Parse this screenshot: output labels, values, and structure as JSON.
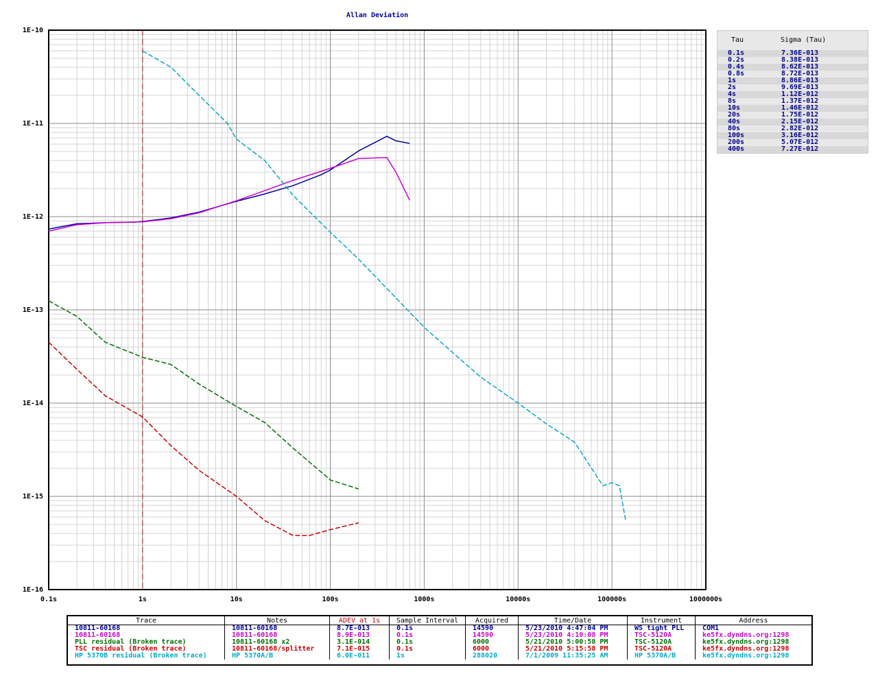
{
  "chart_data": {
    "type": "line",
    "title": "Allan Deviation",
    "x_scale": "log",
    "y_scale": "log",
    "xlim": [
      0.1,
      1000000
    ],
    "ylim": [
      1e-16,
      1e-10
    ],
    "grid": true,
    "x_tick_labels": [
      "0.1s",
      "1s",
      "10s",
      "100s",
      "1000s",
      "10000s",
      "100000s",
      "1000000s"
    ],
    "y_tick_labels": [
      "1E-10",
      "1E-11",
      "1E-12",
      "1E-13",
      "1E-14",
      "1E-15",
      "1E-16"
    ],
    "marker_tau": 1,
    "series": [
      {
        "name": "10811-60168",
        "color": "#0000aa",
        "dashed": false,
        "x": [
          0.1,
          0.2,
          0.4,
          0.8,
          1,
          2,
          4,
          8,
          10,
          20,
          40,
          80,
          100,
          200,
          400,
          500,
          700
        ],
        "y": [
          7.36e-13,
          8.38e-13,
          8.62e-13,
          8.72e-13,
          8.86e-13,
          9.69e-13,
          1.12e-12,
          1.37e-12,
          1.46e-12,
          1.75e-12,
          2.15e-12,
          2.82e-12,
          3.16e-12,
          5.07e-12,
          7.27e-12,
          6.5e-12,
          6.1e-12
        ]
      },
      {
        "name": "10811-60168",
        "color": "#cc00cc",
        "dashed": false,
        "x": [
          0.1,
          0.2,
          0.4,
          1,
          2,
          4,
          10,
          20,
          40,
          100,
          200,
          400,
          500,
          700
        ],
        "y": [
          7e-13,
          8.2e-13,
          8.6e-13,
          8.8e-13,
          9.5e-13,
          1.1e-12,
          1.48e-12,
          1.9e-12,
          2.45e-12,
          3.3e-12,
          4.2e-12,
          4.3e-12,
          3e-12,
          1.5e-12
        ]
      },
      {
        "name": "PLL residual (Broken trace)",
        "color": "#007000",
        "dashed": true,
        "x": [
          0.1,
          0.2,
          0.4,
          1,
          2,
          4,
          10,
          20,
          40,
          100,
          200
        ],
        "y": [
          1.25e-13,
          8.5e-14,
          4.5e-14,
          3.1e-14,
          2.6e-14,
          1.6e-14,
          9.2e-15,
          6.2e-15,
          3.3e-15,
          1.5e-15,
          1.2e-15
        ]
      },
      {
        "name": "TSC residual (Broken trace)",
        "color": "#cc0000",
        "dashed": true,
        "x": [
          0.1,
          0.2,
          0.4,
          1,
          2,
          4,
          10,
          20,
          40,
          60,
          100,
          200
        ],
        "y": [
          4.5e-14,
          2.3e-14,
          1.2e-14,
          7.1e-15,
          3.5e-15,
          1.9e-15,
          1e-15,
          5.5e-16,
          3.8e-16,
          3.8e-16,
          4.4e-16,
          5.2e-16
        ]
      },
      {
        "name": "HP 5370B residual (Broken trace)",
        "color": "#00aacc",
        "dashed": true,
        "x": [
          1,
          2,
          4,
          8,
          10,
          20,
          40,
          100,
          200,
          400,
          1000,
          2000,
          4000,
          10000,
          20000,
          40000,
          80000,
          100000,
          120000,
          140000
        ],
        "y": [
          6e-11,
          4e-11,
          2e-11,
          1e-11,
          6.8e-12,
          4e-12,
          1.7e-12,
          6.8e-13,
          3.5e-13,
          1.7e-13,
          6.5e-14,
          3.5e-14,
          1.9e-14,
          1e-14,
          6e-15,
          3.8e-15,
          1.3e-15,
          1.4e-15,
          1.3e-15,
          5.5e-16
        ]
      }
    ]
  },
  "tau_table": {
    "header_tau": "Tau",
    "header_sigma": "Sigma (Tau)",
    "rows": [
      {
        "tau": "0.1s",
        "sigma": "7.36E-013"
      },
      {
        "tau": "0.2s",
        "sigma": "8.38E-013"
      },
      {
        "tau": "0.4s",
        "sigma": "8.62E-013"
      },
      {
        "tau": "0.8s",
        "sigma": "8.72E-013"
      },
      {
        "tau": "1s",
        "sigma": "8.86E-013"
      },
      {
        "tau": "2s",
        "sigma": "9.69E-013"
      },
      {
        "tau": "4s",
        "sigma": "1.12E-012"
      },
      {
        "tau": "8s",
        "sigma": "1.37E-012"
      },
      {
        "tau": "10s",
        "sigma": "1.46E-012"
      },
      {
        "tau": "20s",
        "sigma": "1.75E-012"
      },
      {
        "tau": "40s",
        "sigma": "2.15E-012"
      },
      {
        "tau": "80s",
        "sigma": "2.82E-012"
      },
      {
        "tau": "100s",
        "sigma": "3.16E-012"
      },
      {
        "tau": "200s",
        "sigma": "5.07E-012"
      },
      {
        "tau": "400s",
        "sigma": "7.27E-012"
      }
    ]
  },
  "legend": {
    "headers": [
      "Trace",
      "Notes",
      "ADEV at 1s",
      "Sample Interval",
      "Acquired",
      "Time/Date",
      "Instrument",
      "Address"
    ],
    "adev_header_color": "#cc0000",
    "rows": [
      {
        "color": "#0000aa",
        "cells": [
          "10811-60168",
          "10811-60168",
          "8.7E-013",
          "0.1s",
          "14590",
          "5/23/2010 4:47:04 PM",
          "WS tight PLL",
          "COM1"
        ]
      },
      {
        "color": "#cc00cc",
        "cells": [
          "10811-60168",
          "10811-60168",
          "8.9E-013",
          "0.1s",
          "14590",
          "5/23/2010 4:10:08 PM",
          "TSC-5120A",
          "ke5fx.dyndns.org:1298"
        ]
      },
      {
        "color": "#007000",
        "cells": [
          "PLL residual (Broken trace)",
          "10811-60168 x2",
          "3.1E-014",
          "0.1s",
          "6000",
          "5/21/2010 5:00:58 PM",
          "TSC-5120A",
          "ke5fx.dyndns.org:1298"
        ]
      },
      {
        "color": "#cc0000",
        "cells": [
          "TSC residual (Broken trace)",
          "10811-60168/splitter",
          "7.1E-015",
          "0.1s",
          "6000",
          "5/21/2010 5:15:58 PM",
          "TSC-5120A",
          "ke5fx.dyndns.org:1298"
        ]
      },
      {
        "color": "#00aacc",
        "cells": [
          "HP 5370B residual (Broken trace)",
          "HP 5370A/B",
          "6.0E-011",
          "1s",
          "288020",
          "7/1/2009 11:35:25 AM",
          "HP 5370A/B",
          "ke5fx.dyndns.org:1298"
        ]
      }
    ]
  }
}
